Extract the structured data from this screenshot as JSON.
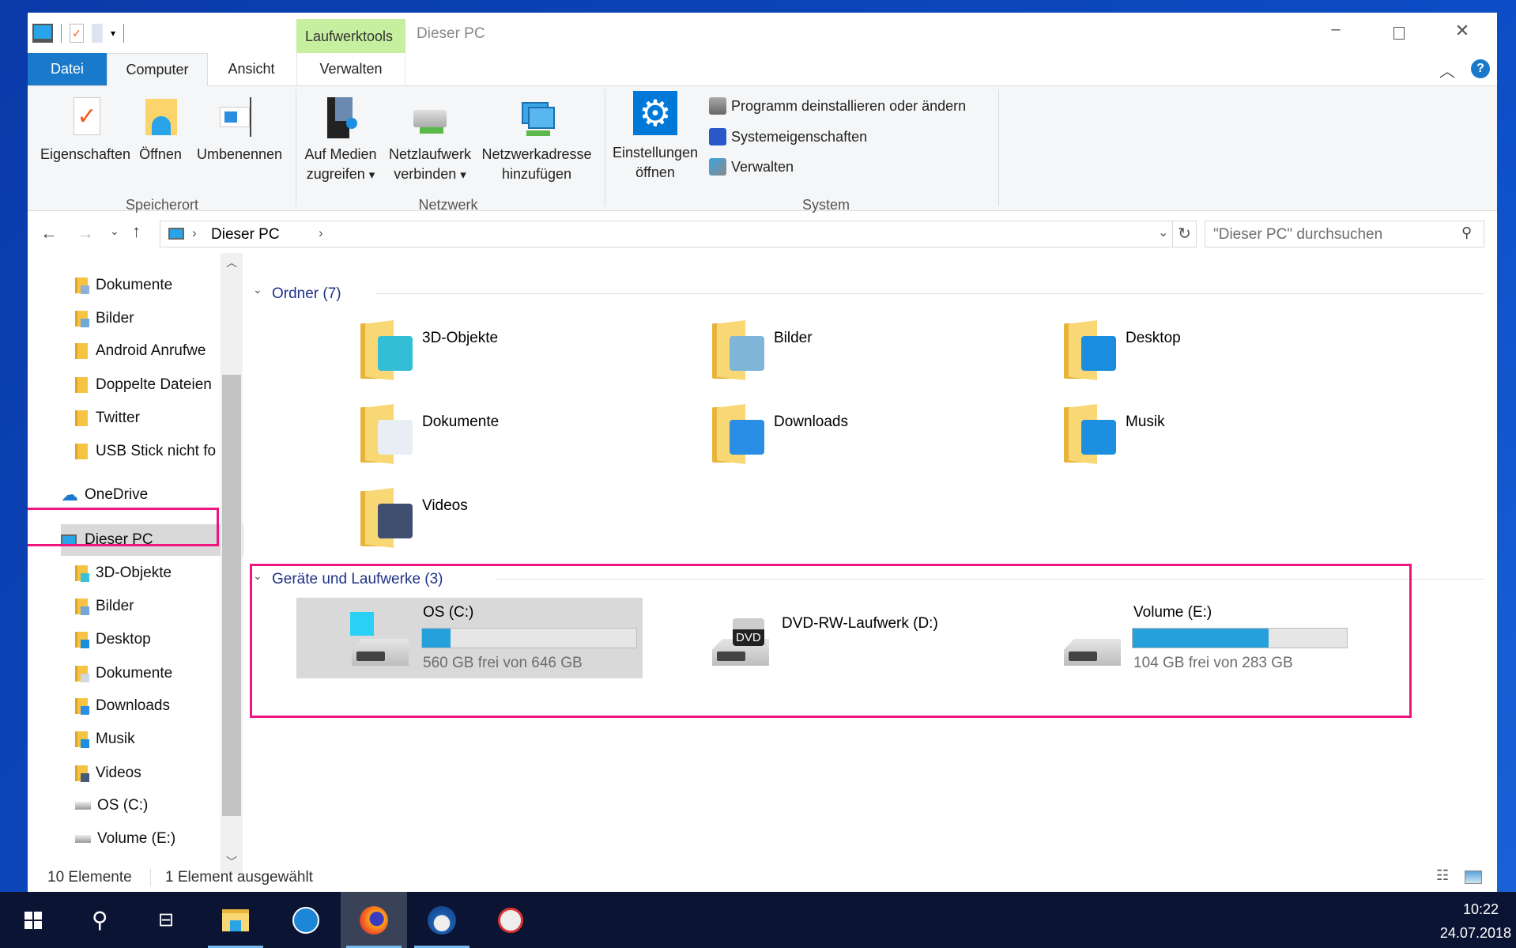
{
  "window": {
    "title": "Dieser PC",
    "context_tab_group": "Laufwerktools"
  },
  "tabs": {
    "datei": "Datei",
    "computer": "Computer",
    "ansicht": "Ansicht",
    "verwalten": "Verwalten"
  },
  "ribbon": {
    "speicherort": {
      "label": "Speicherort",
      "eigenschaften": "Eigenschaften",
      "oeffnen": "Öffnen",
      "umbenennen": "Umbenennen"
    },
    "netzwerk": {
      "label": "Netzwerk",
      "medien_1": "Auf Medien",
      "medien_2": "zugreifen",
      "netzlw_1": "Netzlaufwerk",
      "netzlw_2": "verbinden",
      "netzadr_1": "Netzwerkadresse",
      "netzadr_2": "hinzufügen"
    },
    "system": {
      "label": "System",
      "einst_1": "Einstellungen",
      "einst_2": "öffnen",
      "programm": "Programm deinstallieren oder ändern",
      "systemeig": "Systemeigenschaften",
      "verwalten": "Verwalten"
    }
  },
  "address": {
    "crumb": "Dieser PC",
    "search_placeholder": "\"Dieser PC\" durchsuchen"
  },
  "nav": {
    "quick": [
      {
        "label": "Dokumente",
        "pinned": true,
        "overlay": "#8fb0d8"
      },
      {
        "label": "Bilder",
        "pinned": true,
        "overlay": "#6ea7d8"
      },
      {
        "label": "Android Anrufwe",
        "pinned": false
      },
      {
        "label": "Doppelte Dateien",
        "pinned": false
      },
      {
        "label": "Twitter",
        "pinned": false
      },
      {
        "label": "USB Stick nicht fo",
        "pinned": false
      }
    ],
    "onedrive": "OneDrive",
    "thispc": "Dieser PC",
    "pc_children": [
      {
        "label": "3D-Objekte",
        "overlay": "#39c1d9"
      },
      {
        "label": "Bilder",
        "overlay": "#6ea7d8"
      },
      {
        "label": "Desktop",
        "overlay": "#1c8ee0"
      },
      {
        "label": "Dokumente",
        "overlay": "#cfd8e3"
      },
      {
        "label": "Downloads",
        "overlay": "#2b8ee6"
      },
      {
        "label": "Musik",
        "overlay": "#1d8fe1"
      },
      {
        "label": "Videos",
        "overlay": "#455a7a"
      },
      {
        "label": "OS (C:)",
        "drive": true
      },
      {
        "label": "Volume (E:)",
        "drive": true
      }
    ]
  },
  "content": {
    "folders_header": "Ordner (7)",
    "folders": [
      {
        "label": "3D-Objekte",
        "overlay": "#32bfd6"
      },
      {
        "label": "Bilder",
        "overlay": "#7fb5d9"
      },
      {
        "label": "Desktop",
        "overlay": "#1a8de0"
      },
      {
        "label": "Dokumente",
        "overlay": "#e9eef4"
      },
      {
        "label": "Downloads",
        "overlay": "#2b8ee6"
      },
      {
        "label": "Musik",
        "overlay": "#1d8fe1"
      },
      {
        "label": "Videos",
        "overlay": "#3e4f70"
      }
    ],
    "drives_header": "Geräte und Laufwerke (3)",
    "drives": [
      {
        "name": "OS (C:)",
        "free_text": "560 GB frei von 646 GB",
        "used_fraction": 0.133,
        "selected": true
      },
      {
        "name": "DVD-RW-Laufwerk (D:)",
        "dvd_label": "DVD"
      },
      {
        "name": "Volume (E:)",
        "free_text": "104 GB frei von 283 GB",
        "used_fraction": 0.633
      }
    ]
  },
  "status": {
    "count": "10 Elemente",
    "selection": "1 Element ausgewählt"
  },
  "taskbar": {
    "time": "10:22",
    "date": "24.07.2018"
  },
  "colors": {
    "accent": "#1979ca",
    "highlight": "#f0147f",
    "bar_fill": "#26a0da",
    "context_tab": "#c6efa0"
  }
}
